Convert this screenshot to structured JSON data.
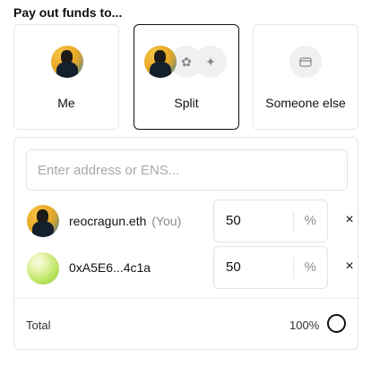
{
  "heading": "Pay out funds to...",
  "options": {
    "me": {
      "label": "Me"
    },
    "split": {
      "label": "Split",
      "selected": true
    },
    "someone_else": {
      "label": "Someone else"
    }
  },
  "icons": {
    "split_extra_1": "✿",
    "split_extra_2": "✦",
    "wallet": "wallet-icon"
  },
  "address_input": {
    "placeholder": "Enter address or ENS...",
    "value": ""
  },
  "recipients": [
    {
      "name": "reocragun.eth",
      "suffix": "(You)",
      "percent": "50",
      "unit": "%"
    },
    {
      "name": "0xA5E6...4c1a",
      "suffix": "",
      "percent": "50",
      "unit": "%"
    }
  ],
  "remove_symbol": "×",
  "total": {
    "label": "Total",
    "value": "100%"
  }
}
